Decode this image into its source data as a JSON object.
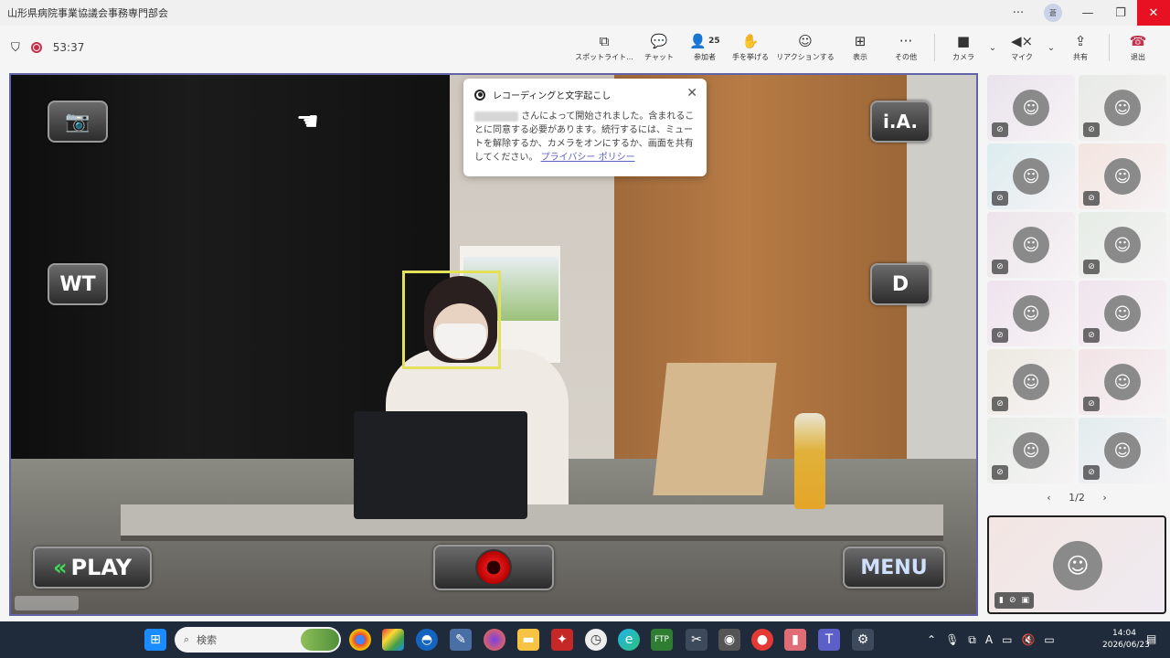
{
  "window": {
    "title": "山形県病院事業協議会事務専門部会",
    "avatar_initial": "蒼"
  },
  "meeting": {
    "timer": "53:37"
  },
  "toolbar": {
    "spotlight": "スポットライト...",
    "chat": "チャット",
    "participants": "参加者",
    "participants_count": "25",
    "raise_hand": "手を挙げる",
    "reactions": "リアクションする",
    "view": "表示",
    "more": "その他",
    "camera": "カメラ",
    "mic": "マイク",
    "share": "共有",
    "leave": "退出"
  },
  "camera_overlay": {
    "wt": "WT",
    "ia": "i.A.",
    "d": "D",
    "play": "PLAY",
    "menu": "MENU"
  },
  "toast": {
    "title": "レコーディングと文字起こし",
    "body": "さんによって開始されました。含まれることに同意する必要があります。続行するには、ミュートを解除するか、カメラをオンにするか、画面を共有してください。",
    "link": "プライバシー ポリシー"
  },
  "gallery": {
    "pager": "1/2",
    "tile_colors": [
      "#e9e3ec",
      "#e7eae6",
      "#dcecef",
      "#f3e4df",
      "#ece4ea",
      "#e5ece5",
      "#efe3ee",
      "#efe4ec",
      "#ece9e0",
      "#f2e3e6",
      "#e6ece6",
      "#e3ecee"
    ]
  },
  "taskbar": {
    "search_placeholder": "検索",
    "time": "14:04",
    "date": "2026/06/23"
  }
}
